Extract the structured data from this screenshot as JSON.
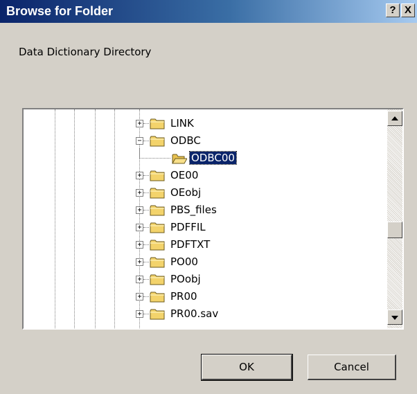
{
  "window": {
    "title": "Browse for Folder",
    "help_label": "?",
    "close_label": "X"
  },
  "description": "Data Dictionary Directory",
  "tree": {
    "items": [
      {
        "label": "LINK",
        "expander": "+"
      },
      {
        "label": "ODBC",
        "expander": "−"
      },
      {
        "label": "ODBC00",
        "selected": true,
        "open": true
      },
      {
        "label": "OE00",
        "expander": "+"
      },
      {
        "label": "OEobj",
        "expander": "+"
      },
      {
        "label": "PBS_files",
        "expander": "+"
      },
      {
        "label": "PDFFIL",
        "expander": "+"
      },
      {
        "label": "PDFTXT",
        "expander": "+"
      },
      {
        "label": "PO00",
        "expander": "+"
      },
      {
        "label": "POobj",
        "expander": "+"
      },
      {
        "label": "PR00",
        "expander": "+"
      },
      {
        "label": "PR00.sav",
        "expander": "+"
      }
    ]
  },
  "buttons": {
    "ok": "OK",
    "cancel": "Cancel"
  },
  "colors": {
    "title_bar_start": "#0a246a",
    "title_bar_end": "#a6caf0",
    "dialog_bg": "#d4d0c8",
    "folder_yellow": "#f3d36b",
    "selection": "#0a246a"
  },
  "icons": {
    "folder": "folder-icon",
    "open_folder": "open-folder-icon",
    "help": "help-icon",
    "close": "close-icon"
  }
}
